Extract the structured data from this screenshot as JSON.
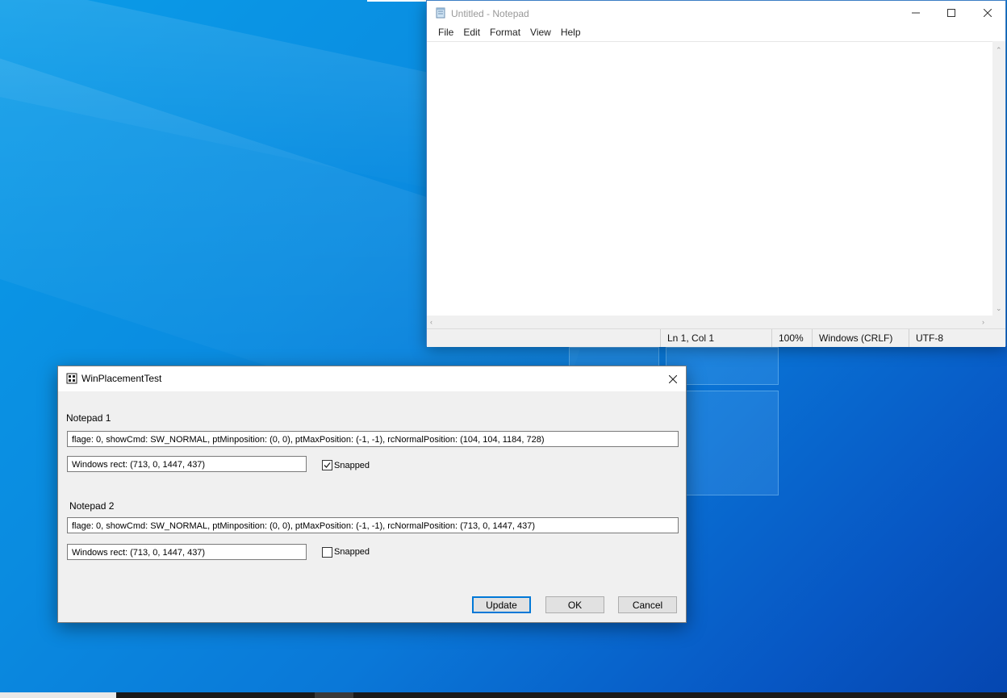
{
  "notepad": {
    "title": "Untitled - Notepad",
    "menus": [
      "File",
      "Edit",
      "Format",
      "View",
      "Help"
    ],
    "controls": {
      "minimize_icon": "minimize-icon",
      "maximize_icon": "maximize-icon",
      "close_icon": "close-icon"
    },
    "status": {
      "position": "Ln 1, Col 1",
      "zoom": "100%",
      "line_ending": "Windows (CRLF)",
      "encoding": "UTF-8"
    }
  },
  "dialog": {
    "title": "WinPlacementTest",
    "notepad1": {
      "label": "Notepad 1",
      "placement": "flage: 0, showCmd: SW_NORMAL, ptMinposition: (0, 0), ptMaxPosition: (-1, -1), rcNormalPosition: (104, 104, 1184, 728)",
      "rect": "Windows rect: (713, 0, 1447, 437)",
      "snapped_label": "Snapped",
      "snapped": true
    },
    "notepad2": {
      "label": "Notepad 2",
      "placement": "flage: 0, showCmd: SW_NORMAL, ptMinposition: (0, 0), ptMaxPosition: (-1, -1), rcNormalPosition: (713, 0, 1447, 437)",
      "rect": "Windows rect: (713, 0, 1447, 437)",
      "snapped_label": "Snapped",
      "snapped": false
    },
    "buttons": {
      "update": "Update",
      "ok": "OK",
      "cancel": "Cancel"
    }
  },
  "colors": {
    "desktop_accent": "#0a78d8",
    "window_border": "#3a7dc4",
    "default_button_border": "#0078d7"
  }
}
